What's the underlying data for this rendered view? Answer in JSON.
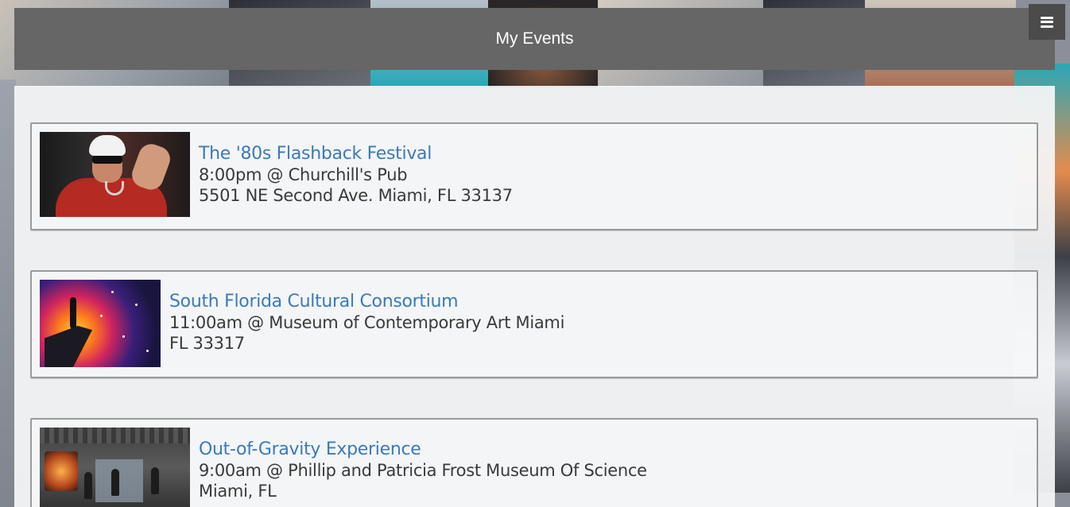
{
  "header": {
    "title": "My Events",
    "menu_icon": "hamburger-menu-icon"
  },
  "events": [
    {
      "title": "The '80s Flashback Festival",
      "time_venue": "8:00pm @ Churchill's Pub",
      "address": "5501 NE Second Ave. Miami, FL 33137"
    },
    {
      "title": "South Florida Cultural Consortium",
      "time_venue": "11:00am @ Museum of Contemporary Art Miami",
      "address": "FL 33317"
    },
    {
      "title": "Out-of-Gravity Experience",
      "time_venue": "9:00am @ Phillip and Patricia Frost Museum Of Science",
      "address": "Miami, FL"
    }
  ],
  "colors": {
    "header_bg": "#666666",
    "link": "#3c7ab8",
    "text": "#3a3a3a"
  }
}
